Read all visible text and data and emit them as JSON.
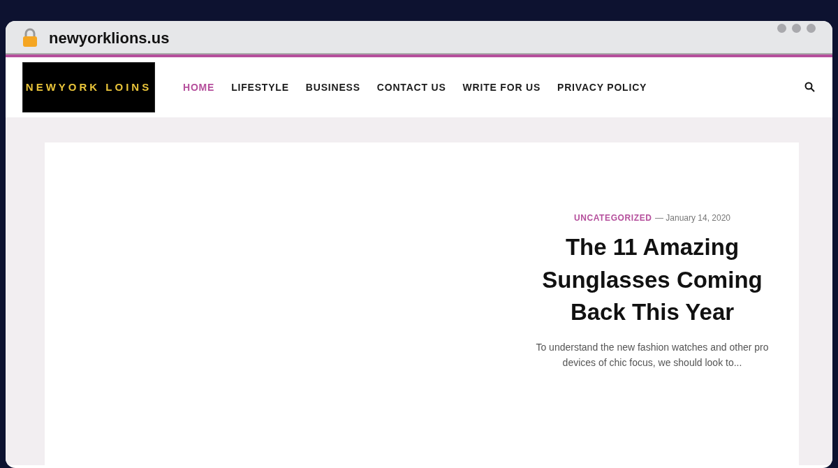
{
  "browser": {
    "address": "newyorklions.us"
  },
  "site": {
    "logo": "NEWYORK LOINS",
    "nav": [
      {
        "label": "HOME",
        "selected": true
      },
      {
        "label": "LIFESTYLE",
        "selected": false
      },
      {
        "label": "BUSINESS",
        "selected": false
      },
      {
        "label": "CONTACT US",
        "selected": false
      },
      {
        "label": "WRITE FOR US",
        "selected": false
      },
      {
        "label": "PRIVACY POLICY",
        "selected": false
      }
    ]
  },
  "featured_post": {
    "category": "UNCATEGORIZED",
    "date": "— January 14, 2020",
    "title": "The 11 Amazing Sunglasses Coming Back This Year",
    "excerpt": "To understand the new fashion watches and other pro devices of chic focus, we should look to..."
  }
}
